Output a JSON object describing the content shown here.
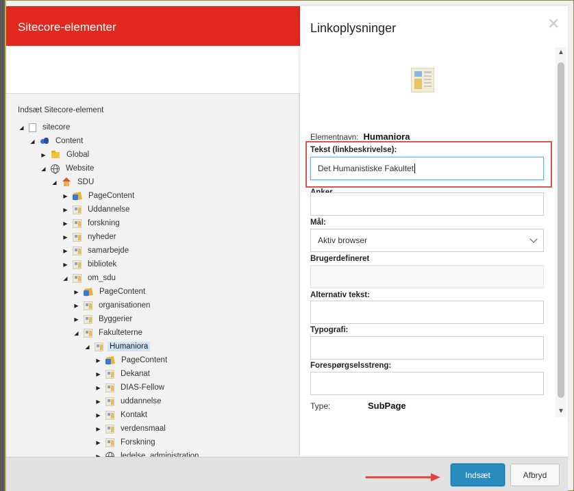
{
  "left_panel": {
    "title": "Sitecore-elementer",
    "subtitle": "Indsæt Sitecore-element",
    "tree": [
      {
        "label": "sitecore",
        "icon": "page-icon",
        "level": 0,
        "expanded": true
      },
      {
        "label": "Content",
        "icon": "content-icon",
        "level": 1,
        "expanded": true
      },
      {
        "label": "Global",
        "icon": "folder-icon",
        "level": 2,
        "expanded": false
      },
      {
        "label": "Website",
        "icon": "globe-icon",
        "level": 2,
        "expanded": true
      },
      {
        "label": "SDU",
        "icon": "home-icon",
        "level": 3,
        "expanded": true
      },
      {
        "label": "PageContent",
        "icon": "pagecontent-icon",
        "level": 4,
        "expanded": false
      },
      {
        "label": "Uddannelse",
        "icon": "template-icon",
        "level": 4,
        "expanded": false
      },
      {
        "label": "forskning",
        "icon": "template-icon",
        "level": 4,
        "expanded": false
      },
      {
        "label": "nyheder",
        "icon": "template-icon",
        "level": 4,
        "expanded": false
      },
      {
        "label": "samarbejde",
        "icon": "template-icon",
        "level": 4,
        "expanded": false
      },
      {
        "label": "bibliotek",
        "icon": "template-icon",
        "level": 4,
        "expanded": false
      },
      {
        "label": "om_sdu",
        "icon": "template-icon",
        "level": 4,
        "expanded": true
      },
      {
        "label": "PageContent",
        "icon": "pagecontent-icon",
        "level": 5,
        "expanded": false
      },
      {
        "label": "organisationen",
        "icon": "template-icon",
        "level": 5,
        "expanded": false
      },
      {
        "label": "Byggerier",
        "icon": "template-icon",
        "level": 5,
        "expanded": false
      },
      {
        "label": "Fakulteterne",
        "icon": "template-icon",
        "level": 5,
        "expanded": true
      },
      {
        "label": "Humaniora",
        "icon": "template-icon",
        "level": 6,
        "expanded": true,
        "selected": true
      },
      {
        "label": "PageContent",
        "icon": "pagecontent-icon",
        "level": 7,
        "expanded": false
      },
      {
        "label": "Dekanat",
        "icon": "template-icon",
        "level": 7,
        "expanded": false
      },
      {
        "label": "DIAS-Fellow",
        "icon": "template-icon",
        "level": 7,
        "expanded": false
      },
      {
        "label": "uddannelse",
        "icon": "template-icon",
        "level": 7,
        "expanded": false
      },
      {
        "label": "Kontakt",
        "icon": "template-icon",
        "level": 7,
        "expanded": false
      },
      {
        "label": "verdensmaal",
        "icon": "template-icon",
        "level": 7,
        "expanded": false
      },
      {
        "label": "Forskning",
        "icon": "template-icon",
        "level": 7,
        "expanded": false
      },
      {
        "label": "ledelse_administration",
        "icon": "globe-icon",
        "level": 7,
        "expanded": false
      }
    ]
  },
  "dialog": {
    "title": "Linkoplysninger",
    "element_name_label": "Elementnavn:",
    "element_name_value": "Humaniora",
    "fields": {
      "text_label": "Tekst (linkbeskrivelse):",
      "text_value": "Det Humanistiske Fakultet",
      "anchor_label": "Anker",
      "anchor_value": "",
      "target_label": "Mål:",
      "target_value": "Aktiv browser",
      "custom_label": "Brugerdefineret",
      "custom_value": "",
      "alt_label": "Alternativ tekst:",
      "alt_value": "",
      "style_label": "Typografi:",
      "style_value": "",
      "query_label": "Forespørgselsstreng:",
      "query_value": "",
      "type_label": "Type:",
      "type_value": "SubPage"
    }
  },
  "footer": {
    "insert_label": "Indsæt",
    "cancel_label": "Afbryd"
  },
  "colors": {
    "header_red": "#e3281f",
    "primary_blue": "#2a8cbd",
    "highlight_red": "#d9534f",
    "selection_blue": "#cfe4f7"
  }
}
